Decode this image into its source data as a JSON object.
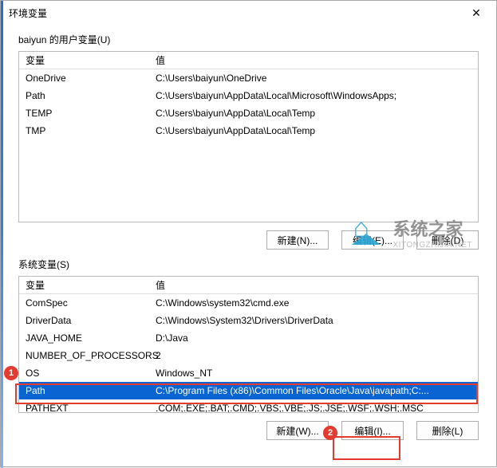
{
  "window": {
    "title": "环境变量"
  },
  "user_section": {
    "label": "baiyun 的用户变量(U)",
    "header_var": "变量",
    "header_val": "值",
    "rows": [
      {
        "name": "OneDrive",
        "value": "C:\\Users\\baiyun\\OneDrive"
      },
      {
        "name": "Path",
        "value": "C:\\Users\\baiyun\\AppData\\Local\\Microsoft\\WindowsApps;"
      },
      {
        "name": "TEMP",
        "value": "C:\\Users\\baiyun\\AppData\\Local\\Temp"
      },
      {
        "name": "TMP",
        "value": "C:\\Users\\baiyun\\AppData\\Local\\Temp"
      }
    ],
    "buttons": {
      "new": "新建(N)...",
      "edit": "编辑(E)...",
      "delete": "删除(D)"
    }
  },
  "sys_section": {
    "label": "系统变量(S)",
    "header_var": "变量",
    "header_val": "值",
    "rows": [
      {
        "name": "ComSpec",
        "value": "C:\\Windows\\system32\\cmd.exe"
      },
      {
        "name": "DriverData",
        "value": "C:\\Windows\\System32\\Drivers\\DriverData"
      },
      {
        "name": "JAVA_HOME",
        "value": "D:\\Java"
      },
      {
        "name": "NUMBER_OF_PROCESSORS",
        "value": "2"
      },
      {
        "name": "OS",
        "value": "Windows_NT"
      },
      {
        "name": "Path",
        "value": "C:\\Program Files (x86)\\Common Files\\Oracle\\Java\\javapath;C:..."
      },
      {
        "name": "PATHEXT",
        "value": ".COM;.EXE;.BAT;.CMD;.VBS;.VBE;.JS;.JSE;.WSF;.WSH;.MSC"
      }
    ],
    "buttons": {
      "new": "新建(W)...",
      "edit": "编辑(I)...",
      "delete": "删除(L)"
    }
  },
  "watermark": {
    "cn": "系统之家",
    "en": "XITONGZHIJIA.NET"
  },
  "annotations": {
    "one": "1",
    "two": "2"
  }
}
